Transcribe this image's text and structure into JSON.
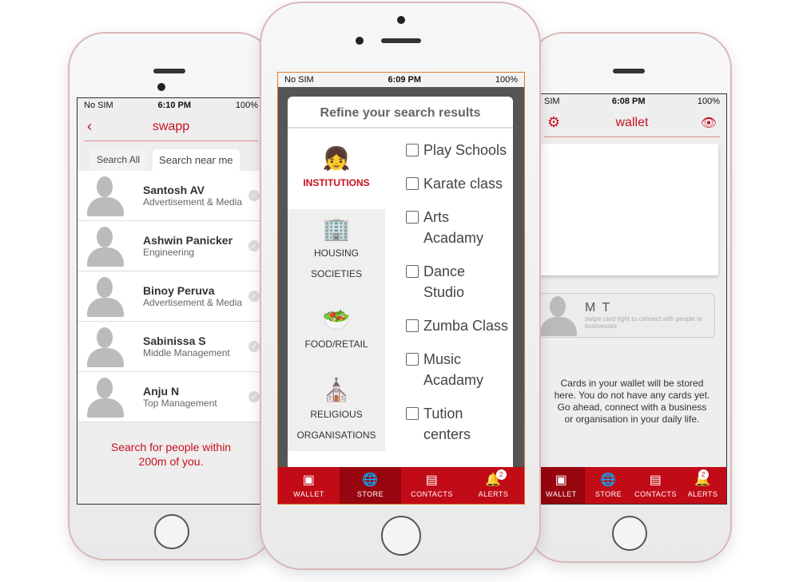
{
  "left": {
    "status": {
      "carrier": "No SIM",
      "time": "6:10 PM",
      "battery": "100%"
    },
    "title": "swapp",
    "tabs": [
      "Search All",
      "Search near me"
    ],
    "people": [
      {
        "name": "Santosh AV",
        "role": "Advertisement & Media"
      },
      {
        "name": "Ashwin Panicker",
        "role": "Engineering"
      },
      {
        "name": "Binoy Peruva",
        "role": "Advertisement & Media"
      },
      {
        "name": "Sabinissa S",
        "role": "Middle Management"
      },
      {
        "name": "Anju N",
        "role": "Top Management"
      }
    ],
    "footer": "Search for people within 200m of you."
  },
  "center": {
    "status": {
      "carrier": "No SIM",
      "time": "6:09 PM",
      "battery": "100%"
    },
    "modal_title": "Refine your search results",
    "categories": [
      {
        "label": "INSTITUTIONS",
        "icon": "girl-icon"
      },
      {
        "label": "HOUSING SOCIETIES",
        "icon": "buildings-icon"
      },
      {
        "label": "FOOD/RETAIL",
        "icon": "food-bowl-icon"
      },
      {
        "label": "RELIGIOUS ORGANISATIONS",
        "icon": "church-icon"
      }
    ],
    "options": [
      "Play Schools",
      "Karate class",
      "Arts Acadamy",
      "Dance Studio",
      "Zumba Class",
      "Music Acadamy",
      "Tution centers"
    ],
    "tabbar": [
      "WALLET",
      "STORE",
      "CONTACTS",
      "ALERTS"
    ],
    "alerts_badge": "2",
    "active_tab": "STORE"
  },
  "right": {
    "status": {
      "carrier": "SIM",
      "time": "6:08 PM",
      "battery": "100%"
    },
    "title": "wallet",
    "card_name": "M T",
    "card_hint": "swipe card right to connect with people or businesses",
    "message": "Cards in your wallet will be stored here. You do not have any cards yet. Go ahead, connect with a business or organisation in your daily life.",
    "tabbar": [
      "WALLET",
      "STORE",
      "CONTACTS",
      "ALERTS"
    ],
    "alerts_badge": "2",
    "active_tab": "WALLET"
  },
  "colors": {
    "brand": "#c10b17",
    "active_tab": "#97050f"
  }
}
